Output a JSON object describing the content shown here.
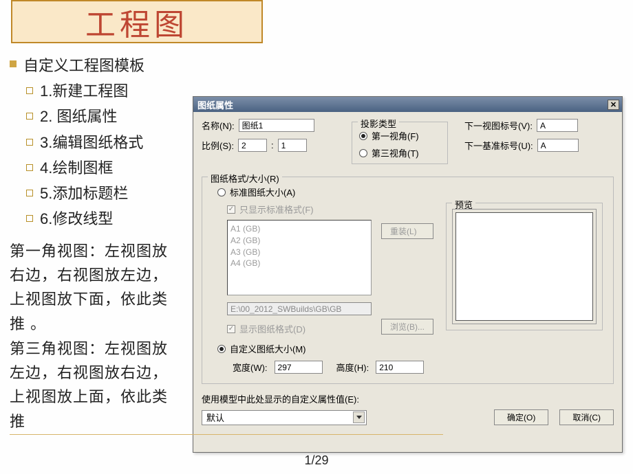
{
  "title": "工程图",
  "outline": {
    "main": "自定义工程图模板",
    "items": [
      "1.新建工程图",
      "2. 图纸属性",
      "3.编辑图纸格式",
      "4.绘制图框",
      "5.添加标题栏",
      "6.修改线型"
    ]
  },
  "paragraph1": "第一角视图：左视图放右边，右视图放左边，上视图放下面，依此类推 。",
  "paragraph2": "第三角视图：左视图放左边，右视图放右边，上视图放上面，依此类推",
  "pageNumber": "1/29",
  "dialog": {
    "title": "图纸属性",
    "labels": {
      "name": "名称(N):",
      "scale": "比例(S):",
      "colon": ":",
      "proj": "投影类型",
      "firstAngle": "第一视角(F)",
      "thirdAngle": "第三视角(T)",
      "nextView": "下一视图标号(V):",
      "nextDatum": "下一基准标号(U):",
      "sheetFmt": "图纸格式/大小(R)",
      "stdSize": "标准图纸大小(A)",
      "onlyStd": "只显示标准格式(F)",
      "reload": "重装(L)",
      "browse": "浏览(B)...",
      "showFmt": "显示图纸格式(D)",
      "customSize": "自定义图纸大小(M)",
      "width": "宽度(W):",
      "height": "高度(H):",
      "preview": "预览",
      "customProp": "使用模型中此处显示的自定义属性值(E):",
      "ok": "确定(O)",
      "cancel": "取消(C)"
    },
    "values": {
      "name": "图纸1",
      "scale1": "2",
      "scale2": "1",
      "nextView": "A",
      "nextDatum": "A",
      "width": "297",
      "height": "210",
      "path": "E:\\00_2012_SWBuilds\\GB\\GB",
      "combo": "默认"
    },
    "sizeList": [
      "A1 (GB)",
      "A2 (GB)",
      "A3 (GB)",
      "A4 (GB)"
    ]
  }
}
